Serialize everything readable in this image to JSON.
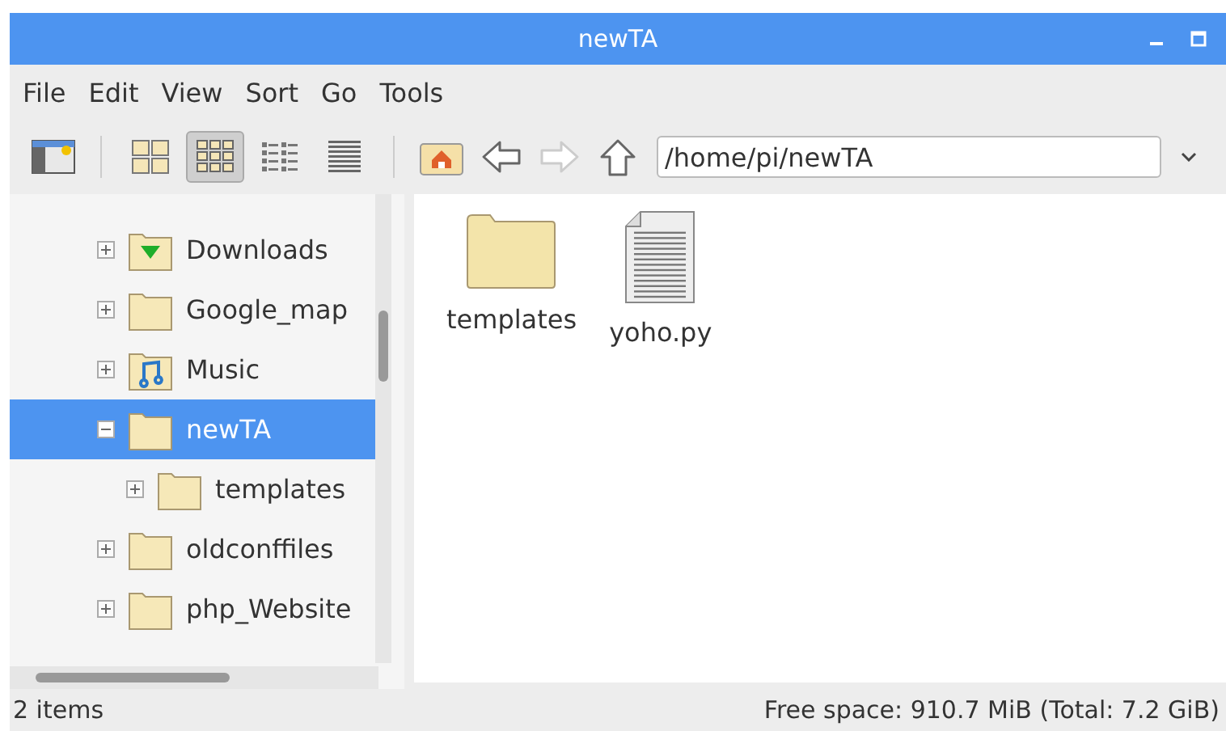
{
  "window": {
    "title": "newTA"
  },
  "menu": [
    "File",
    "Edit",
    "View",
    "Sort",
    "Go",
    "Tools"
  ],
  "view_modes": [
    {
      "kind": "icons",
      "selected": false
    },
    {
      "kind": "thumbnails",
      "selected": true
    },
    {
      "kind": "compact",
      "selected": false
    },
    {
      "kind": "list",
      "selected": false
    }
  ],
  "nav": [
    {
      "kind": "back",
      "disabled": false
    },
    {
      "kind": "forward",
      "disabled": true
    },
    {
      "kind": "up",
      "disabled": false
    }
  ],
  "path": {
    "value": "/home/pi/newTA"
  },
  "tree": [
    {
      "label": "Downloads",
      "kind": "downloads",
      "expanded": false,
      "selected": false
    },
    {
      "label": "Google_map",
      "kind": "folder",
      "expanded": false,
      "selected": false
    },
    {
      "label": "Music",
      "kind": "music",
      "expanded": false,
      "selected": false
    },
    {
      "label": "newTA",
      "kind": "folder",
      "expanded": true,
      "selected": true,
      "children": [
        {
          "label": "templates",
          "kind": "folder",
          "expanded": false,
          "selected": false
        }
      ]
    },
    {
      "label": "oldconffiles",
      "kind": "folder",
      "expanded": false,
      "selected": false
    },
    {
      "label": "php_Website",
      "kind": "folder",
      "expanded": false,
      "selected": false
    }
  ],
  "files": [
    {
      "name": "templates",
      "kind": "folder"
    },
    {
      "name": "yoho.py",
      "kind": "text"
    }
  ],
  "status_bar": {
    "items": "2 items",
    "free_space": "Free space: 910.7 MiB (Total: 7.2 GiB)"
  }
}
